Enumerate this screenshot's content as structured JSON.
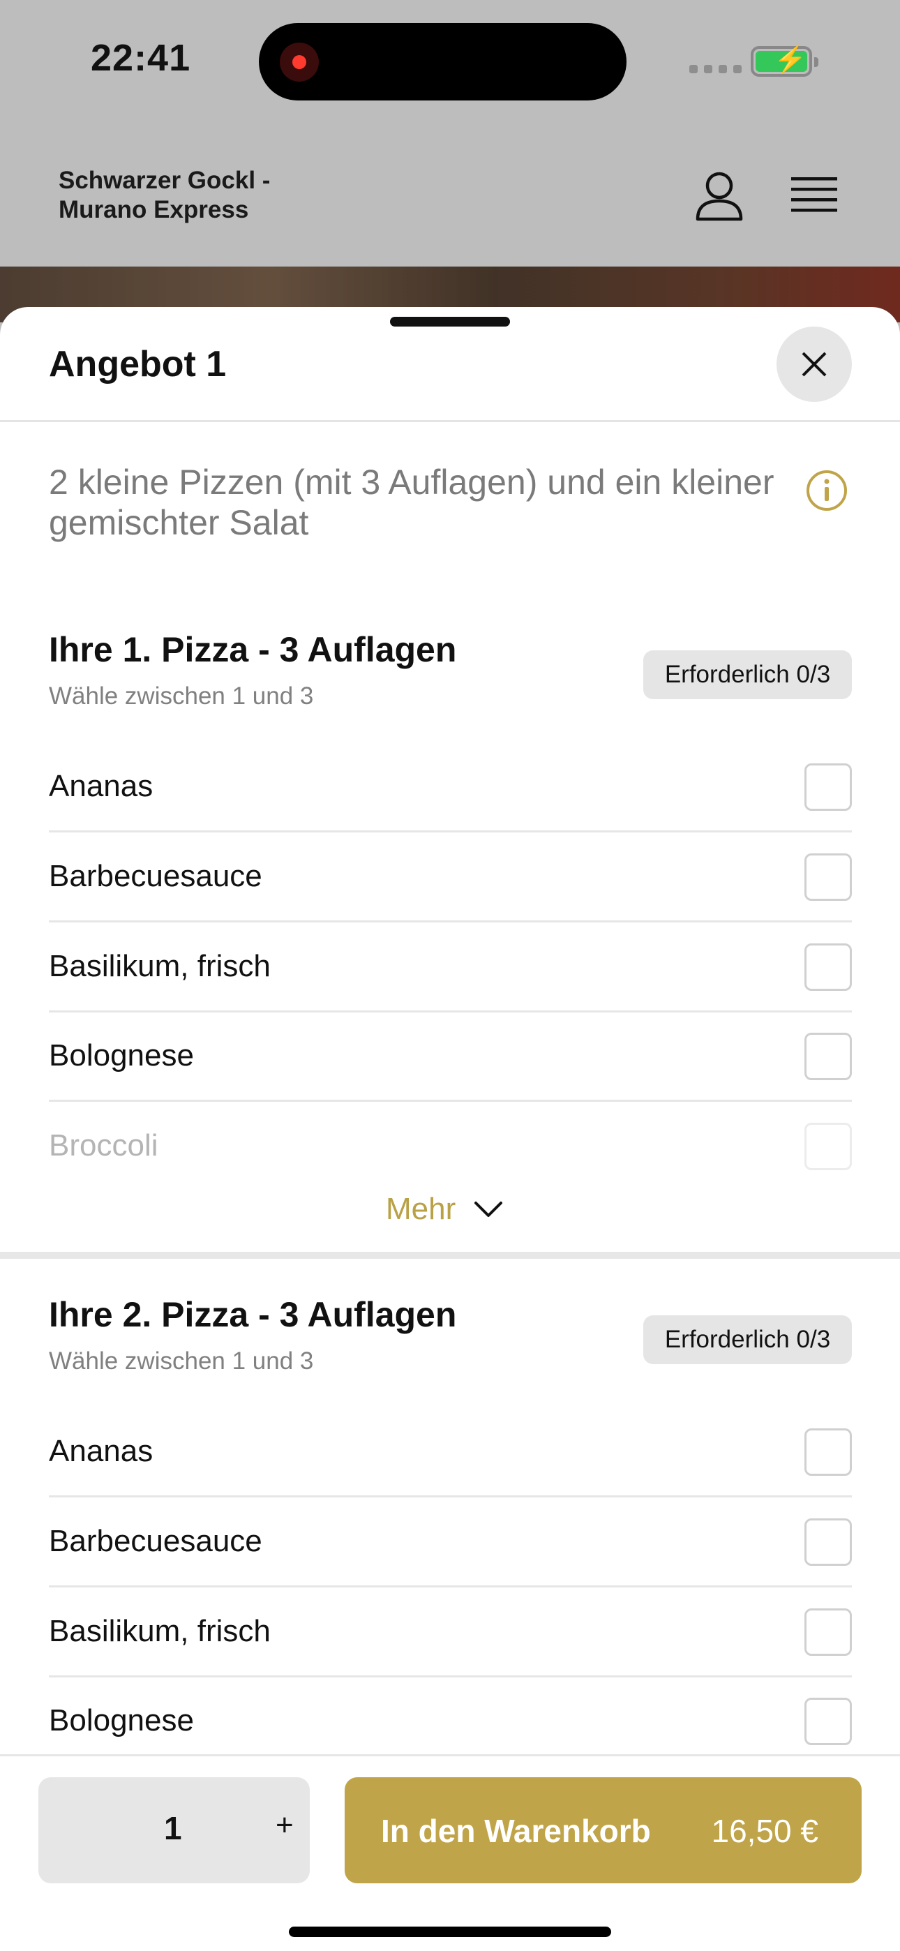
{
  "status": {
    "time": "22:41"
  },
  "header": {
    "restaurant_name": "Schwarzer Gockl - Murano Express"
  },
  "sheet": {
    "title": "Angebot 1",
    "description": "2 kleine Pizzen (mit 3 Auflagen) und ein kleiner gemischter Salat"
  },
  "groups": [
    {
      "title": "Ihre 1. Pizza - 3 Auflagen",
      "subtitle": "Wähle zwischen 1 und 3",
      "badge": "Erforderlich 0/3",
      "options": [
        "Ananas",
        "Barbecuesauce",
        "Basilikum, frisch",
        "Bolognese",
        "Broccoli"
      ],
      "more_label": "Mehr"
    },
    {
      "title": "Ihre 2. Pizza - 3 Auflagen",
      "subtitle": "Wähle zwischen 1 und 3",
      "badge": "Erforderlich 0/3",
      "options": [
        "Ananas",
        "Barbecuesauce",
        "Basilikum, frisch",
        "Bolognese"
      ]
    }
  ],
  "footer": {
    "quantity": "1",
    "plus": "+",
    "cart_label": "In den Warenkorb",
    "price": "16,50 €"
  },
  "colors": {
    "accent": "#c0a449",
    "badge_bg": "#e5e5e5",
    "battery": "#34c759"
  }
}
